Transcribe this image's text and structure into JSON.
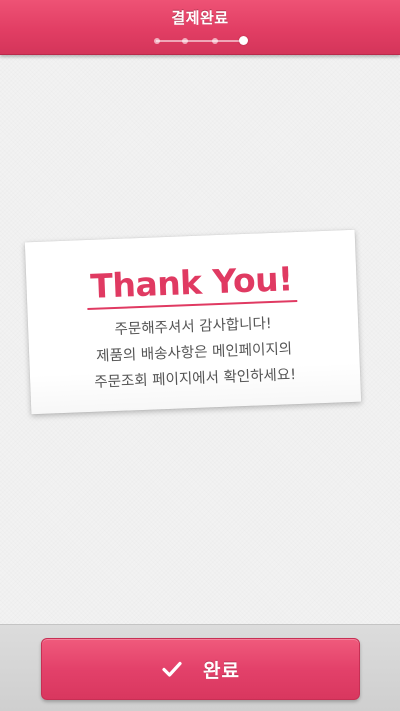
{
  "header": {
    "title": "결제완료",
    "steps_total": 4,
    "steps_current": 4
  },
  "note": {
    "headline": "Thank You!",
    "lines": [
      "주문해주셔서 감사합니다!",
      "제품의 배송사항은 메인페이지의",
      "주문조회 페이지에서 확인하세요!"
    ]
  },
  "footer": {
    "done_label": "완료",
    "done_icon": "check-icon"
  },
  "colors": {
    "accent": "#e03a62",
    "header": "#e23e64",
    "text": "#555555"
  }
}
